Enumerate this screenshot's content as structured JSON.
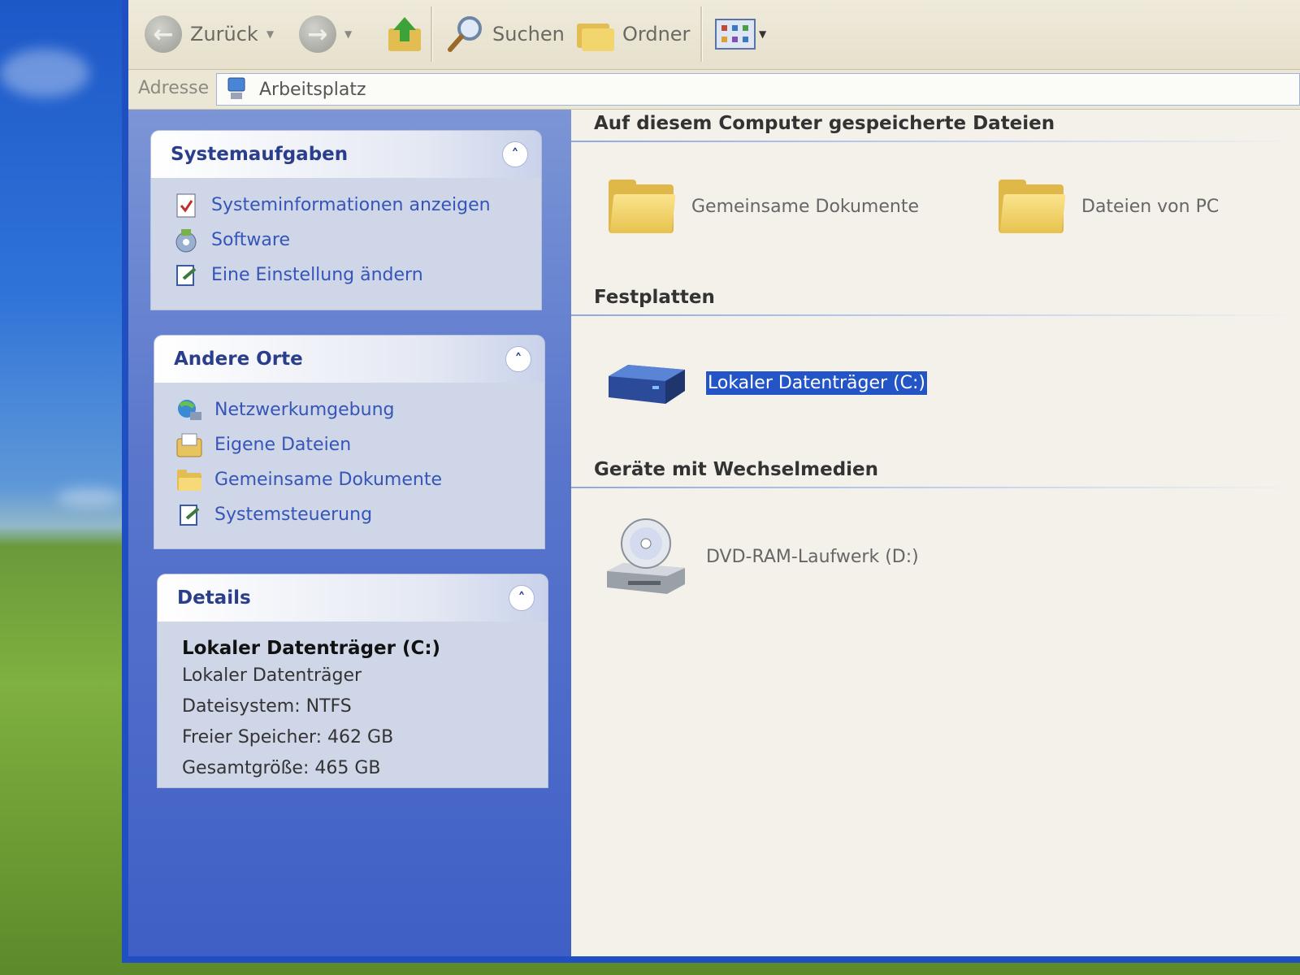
{
  "toolbar": {
    "back_label": "Zurück",
    "search_label": "Suchen",
    "folders_label": "Ordner"
  },
  "address": {
    "label": "Adresse",
    "value": "Arbeitsplatz"
  },
  "tasks": {
    "title": "Systemaufgaben",
    "items": [
      {
        "label": "Systeminformationen anzeigen",
        "icon": "system-info-icon"
      },
      {
        "label": "Software",
        "icon": "software-icon"
      },
      {
        "label": "Eine Einstellung ändern",
        "icon": "control-panel-icon"
      }
    ]
  },
  "places": {
    "title": "Andere Orte",
    "items": [
      {
        "label": "Netzwerkumgebung",
        "icon": "network-icon"
      },
      {
        "label": "Eigene Dateien",
        "icon": "my-documents-icon"
      },
      {
        "label": "Gemeinsame Dokumente",
        "icon": "folder-icon"
      },
      {
        "label": "Systemsteuerung",
        "icon": "control-panel-icon"
      }
    ]
  },
  "details": {
    "title": "Details",
    "name": "Lokaler Datenträger (C:)",
    "type": "Lokaler Datenträger",
    "filesystem": "Dateisystem: NTFS",
    "free": "Freier Speicher: 462 GB",
    "total": "Gesamtgröße: 465 GB"
  },
  "content": {
    "stored_files_title": "Auf diesem Computer gespeicherte Dateien",
    "stored_files": [
      {
        "label": "Gemeinsame Dokumente",
        "icon": "folder-icon"
      },
      {
        "label": "Dateien von PC",
        "icon": "folder-icon"
      }
    ],
    "hard_disks_title": "Festplatten",
    "hard_disks": [
      {
        "label": "Lokaler Datenträger (C:)",
        "icon": "hard-drive-icon",
        "selected": true
      }
    ],
    "removable_title": "Geräte mit Wechselmedien",
    "removable": [
      {
        "label": "DVD-RAM-Laufwerk (D:)",
        "icon": "dvd-drive-icon"
      }
    ]
  },
  "colors": {
    "taskpane_blue": "#3f5fc6",
    "selection": "#2455c6",
    "link": "#3555b8"
  }
}
